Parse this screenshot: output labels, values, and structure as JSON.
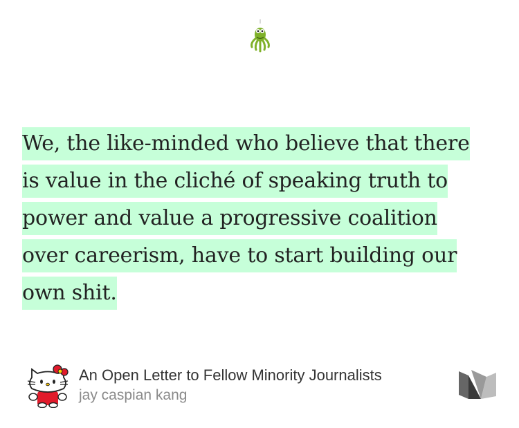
{
  "icons": {
    "top": "green-octopus-icon",
    "avatar": "hello-kitty-avatar",
    "brand": "medium-logo"
  },
  "highlight_color": "#c6ffd9",
  "quote": {
    "lines": [
      "We, the like-minded who believe that there",
      "is value in the cliché of speaking truth to",
      "power and value a progressive coalition",
      "over careerism, have to start building our",
      "own shit."
    ]
  },
  "article": {
    "title": "An Open Letter to Fellow Minority Journalists",
    "author": "jay caspian kang"
  }
}
